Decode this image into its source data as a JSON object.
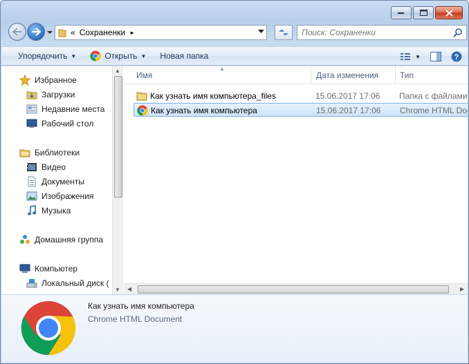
{
  "window": {
    "caption": {
      "minimize": "minimize",
      "maximize": "maximize",
      "close": "close"
    }
  },
  "nav": {
    "breadcrumb_prefix": "«",
    "breadcrumb": "Сохраненки",
    "breadcrumb_sep": "►",
    "search_placeholder": "Поиск: Сохраненки"
  },
  "toolbar": {
    "organize": "Упорядочить",
    "open": "Открыть",
    "new_folder": "Новая папка"
  },
  "sidebar": {
    "favorites": "Избранное",
    "downloads": "Загрузки",
    "recent": "Недавние места",
    "desktop": "Рабочий стол",
    "libraries": "Библиотеки",
    "video": "Видео",
    "documents": "Документы",
    "pictures": "Изображения",
    "music": "Музыка",
    "homegroup": "Домашняя группа",
    "computer": "Компьютер",
    "local_disk": "Локальный диск ("
  },
  "columns": {
    "name": "Имя",
    "date": "Дата изменения",
    "type": "Тип"
  },
  "files": [
    {
      "name": "Как узнать имя компьютера_files",
      "date": "15.06.2017 17:06",
      "type": "Папка с файлами",
      "icon": "folder-icon"
    },
    {
      "name": "Как узнать имя компьютера",
      "date": "15.06.2017 17:06",
      "type": "Chrome HTML Document",
      "icon": "chrome-icon"
    }
  ],
  "details": {
    "name": "Как узнать имя компьютера",
    "type": "Chrome HTML Document"
  }
}
